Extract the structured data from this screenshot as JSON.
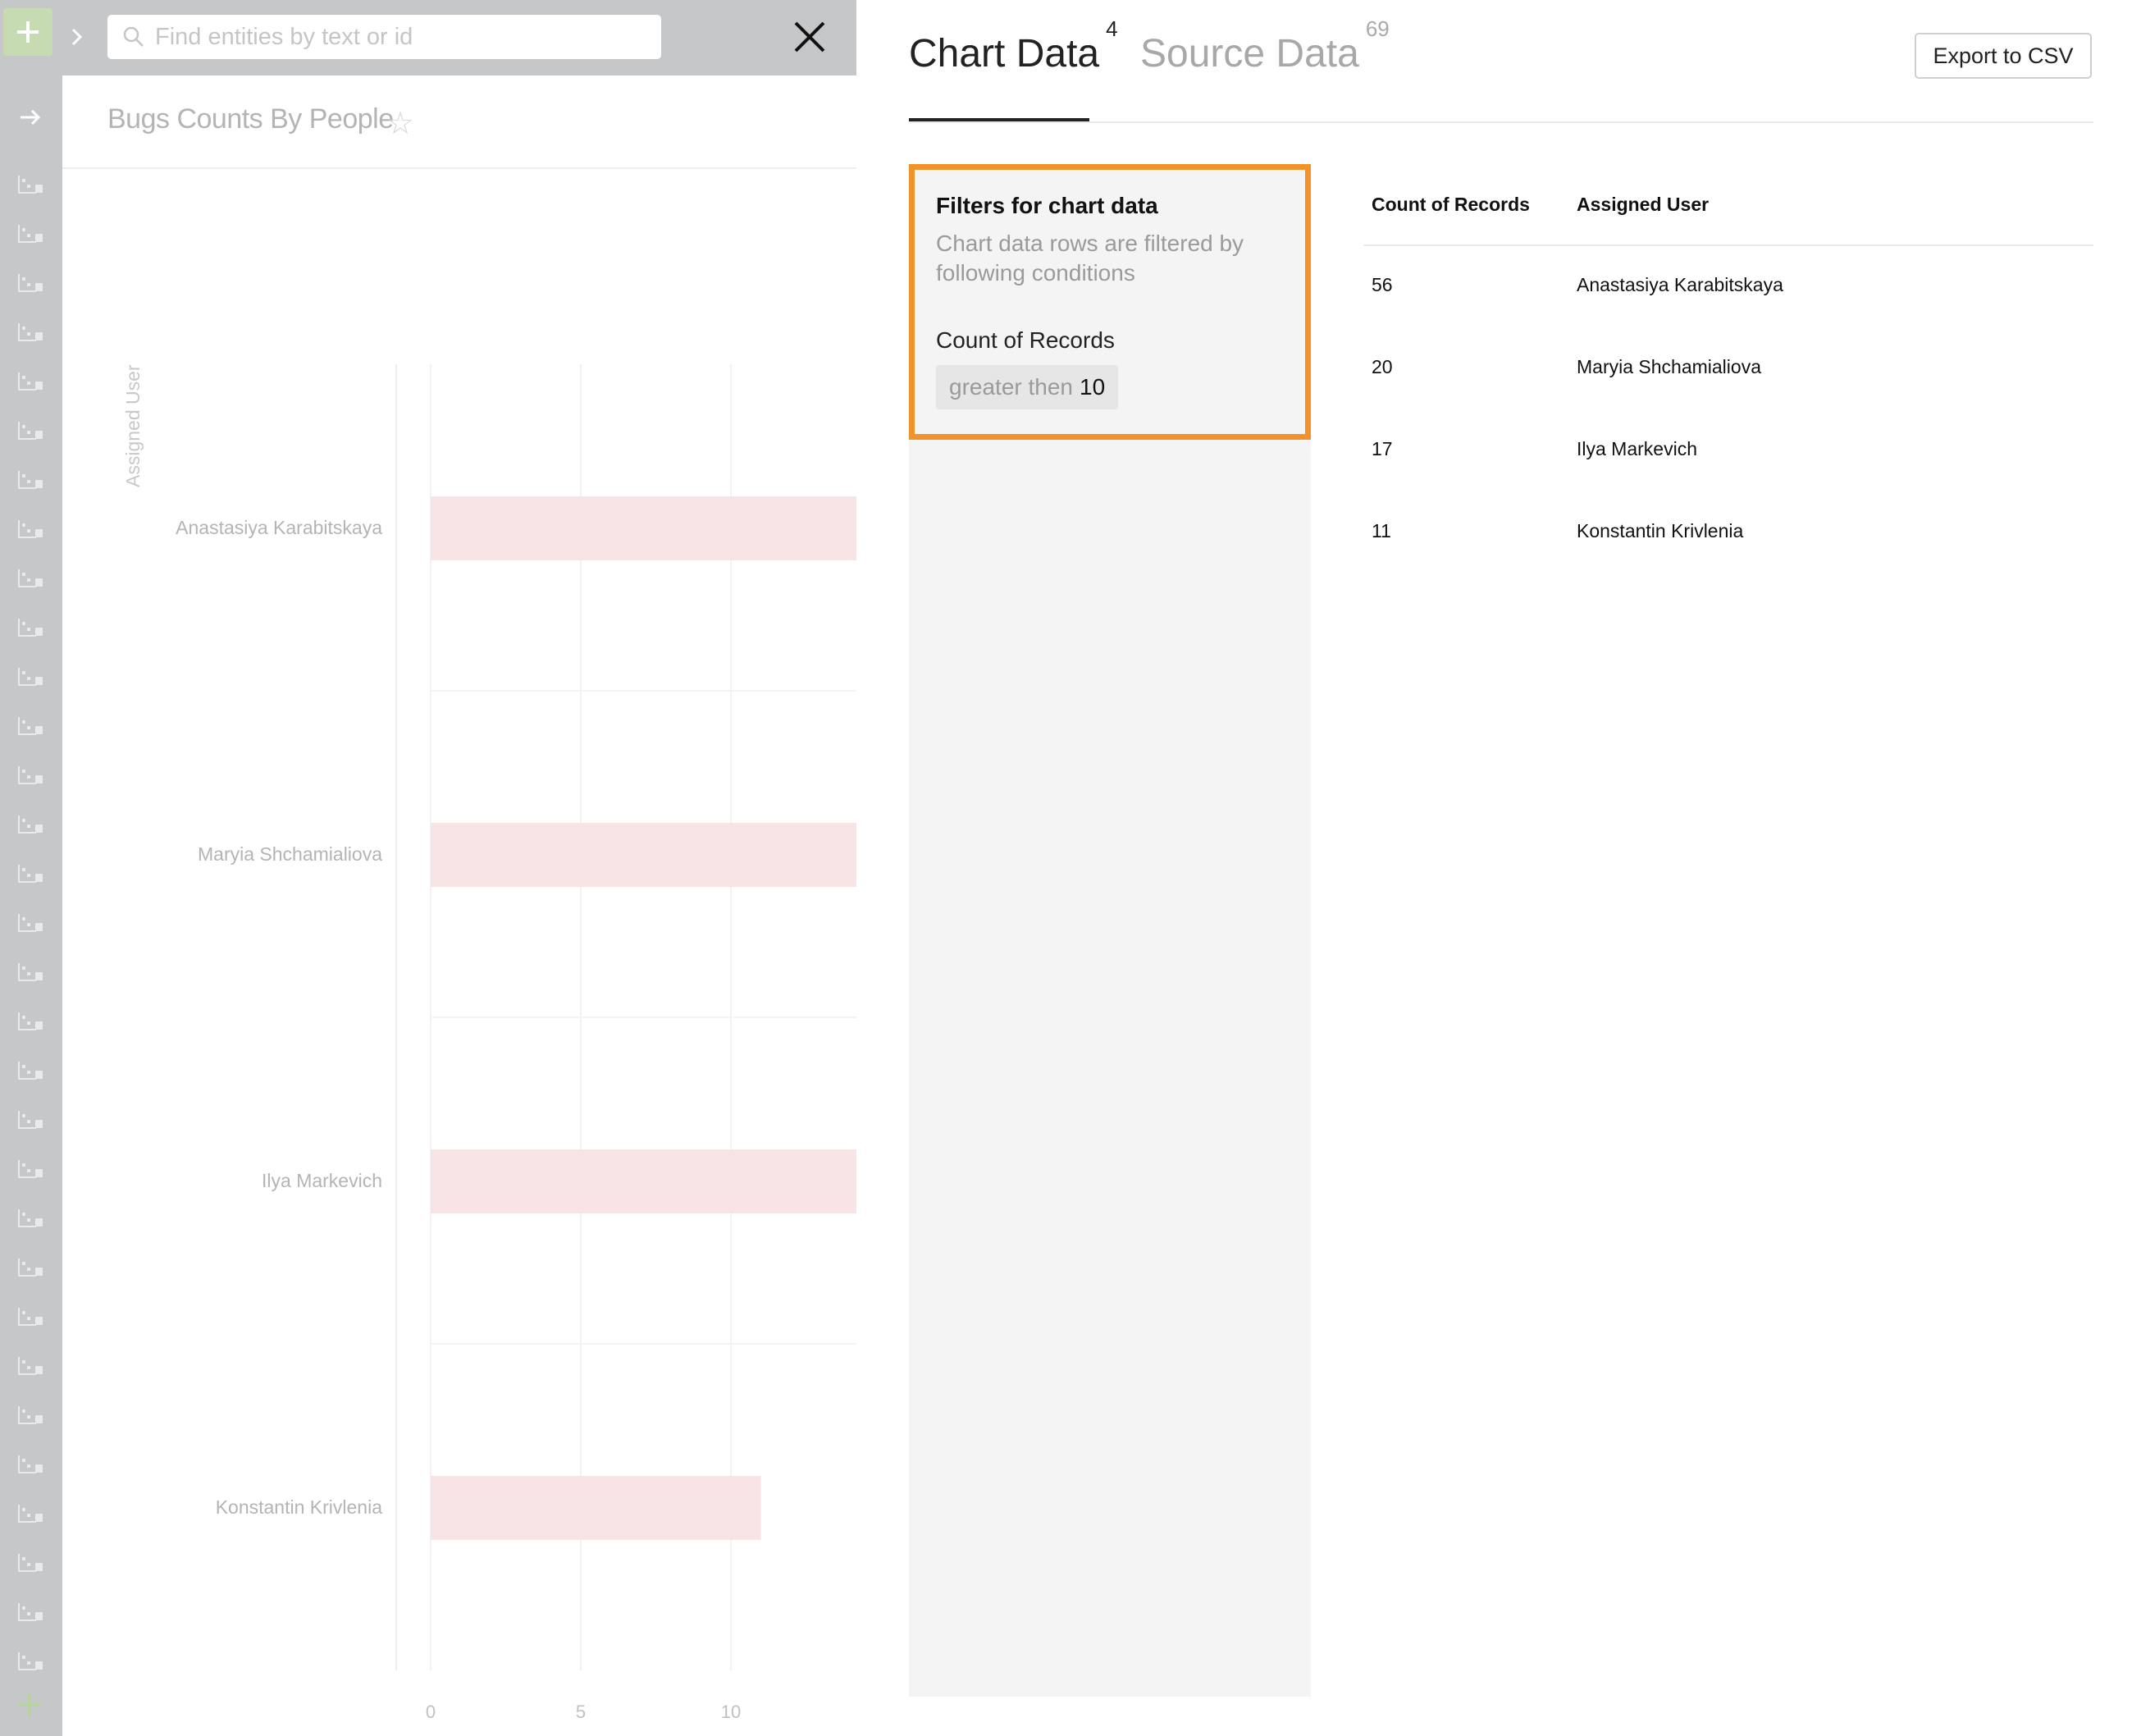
{
  "search": {
    "placeholder": "Find entities by text or id"
  },
  "dashboard": {
    "title": "Bugs Counts By People"
  },
  "panel": {
    "tabs": [
      {
        "label": "Chart Data",
        "count": "4"
      },
      {
        "label": "Source Data",
        "count": "69"
      }
    ],
    "export_label": "Export to CSV",
    "filters": {
      "title": "Filters for chart data",
      "description": "Chart data rows are filtered by following conditions",
      "field": "Count of Records",
      "operator": "greater then",
      "value": "10"
    },
    "table": {
      "columns": [
        "Count of Records",
        "Assigned User"
      ],
      "rows": [
        [
          "56",
          "Anastasiya Karabitskaya"
        ],
        [
          "20",
          "Maryia Shchamialiova"
        ],
        [
          "17",
          "Ilya Markevich"
        ],
        [
          "11",
          "Konstantin Krivlenia"
        ]
      ]
    }
  },
  "chart_data": {
    "type": "bar",
    "orientation": "horizontal",
    "ylabel": "Assigned User",
    "categories": [
      "Anastasiya Karabitskaya",
      "Maryia Shchamialiova",
      "Ilya Markevich",
      "Konstantin Krivlenia"
    ],
    "values": [
      56,
      20,
      17,
      11
    ],
    "x_ticks": [
      "0",
      "5",
      "10"
    ],
    "bar_color": "#f8e4e4"
  },
  "colors": {
    "highlight_border": "#f2922a",
    "sidebar_bg": "#c6c7c8",
    "add_button": "#c7dbb3"
  },
  "icons": {
    "add": "plus-icon",
    "search": "search-icon",
    "close": "close-icon",
    "star": "star-icon",
    "expand": "arrow-right-icon"
  }
}
